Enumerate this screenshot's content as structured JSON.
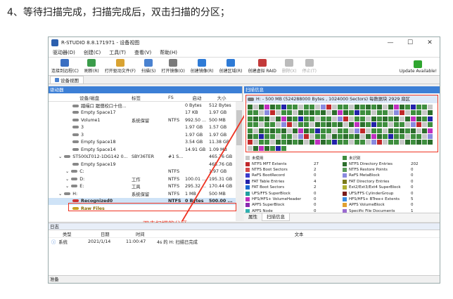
{
  "caption": "4、等待扫描完成，扫描完成后，双击扫描的分区；",
  "window": {
    "title": "R-STUDIO 8.8.171971 - 设备视图",
    "controls": [
      "—",
      "☐",
      "✕"
    ]
  },
  "menu": [
    "驱动器(D)",
    "创建(C)",
    "工具(T)",
    "查看(V)",
    "帮助(H)"
  ],
  "toolbar": [
    {
      "label": "连接到远程(C)",
      "color": "#3a6fc2",
      "disabled": false
    },
    {
      "label": "刷新(R)",
      "color": "#3a9c4a",
      "disabled": false
    },
    {
      "label": "打开驱动文件(F)",
      "color": "#d9a332",
      "disabled": false
    },
    {
      "label": "扫描(S)",
      "color": "#4a82d0",
      "disabled": false
    },
    {
      "label": "打开镜像(O)",
      "color": "#7a7a7a",
      "disabled": false
    },
    {
      "label": "创建镜像(R)",
      "color": "#2f7bd6",
      "disabled": false
    },
    {
      "label": "创建区域(R)",
      "color": "#2f7bd6",
      "disabled": false
    },
    {
      "label": "创建虚拟 RAID",
      "color": "#c33a3a",
      "disabled": false
    },
    {
      "label": "删除(X)",
      "color": "#bbbbbb",
      "disabled": true
    },
    {
      "label": "停止(T)",
      "color": "#bbbbbb",
      "disabled": true
    },
    {
      "label": "Update Available!",
      "color": "#2fa52f",
      "disabled": false
    }
  ],
  "tab": "设备视图",
  "left_panel": {
    "header": "驱动器",
    "columns": [
      "设备/磁盘",
      "标签",
      "FS",
      "启动",
      "大小"
    ],
    "rows": [
      {
        "indent": 34,
        "name": "踏缉口  踞僧校口十倍...",
        "label": "",
        "fs": "",
        "start": "0 Bytes",
        "size": "512 Bytes",
        "sel": false,
        "raw": false
      },
      {
        "indent": 34,
        "name": "Empty Space17",
        "label": "",
        "fs": "",
        "start": "17 KB",
        "size": "1.97 GB",
        "sel": false,
        "raw": false
      },
      {
        "indent": 34,
        "name": "Volume1",
        "label": "系统保留",
        "fs": "NTFS",
        "start": "992.50 ...",
        "size": "500 MB",
        "sel": false,
        "raw": false
      },
      {
        "indent": 34,
        "name": "3",
        "label": "",
        "fs": "",
        "start": "1.97 GB",
        "size": "1.57 GB",
        "sel": false,
        "raw": false
      },
      {
        "indent": 34,
        "name": "3",
        "label": "",
        "fs": "",
        "start": "1.97 GB",
        "size": "1.97 GB",
        "sel": false,
        "raw": false
      },
      {
        "indent": 34,
        "name": "Empty Space18",
        "label": "",
        "fs": "",
        "start": "3.54 GB",
        "size": "11.38 GB",
        "sel": false,
        "raw": false
      },
      {
        "indent": 34,
        "name": "Empty Space14",
        "label": "",
        "fs": "",
        "start": "14.91 GB",
        "size": "1.09 MB",
        "sel": false,
        "raw": false
      },
      {
        "indent": 14,
        "name": "ST500LT012-1DG142 0...",
        "label": "SBY36TER",
        "fs": "#1 S...",
        "start": "",
        "size": "465.76 GB",
        "sel": false,
        "raw": false
      },
      {
        "indent": 34,
        "name": "Empty Space19",
        "label": "",
        "fs": "",
        "start": "",
        "size": "465.76 GB",
        "sel": false,
        "raw": false
      },
      {
        "indent": 24,
        "name": "C:",
        "label": "",
        "fs": "NTFS",
        "start": "",
        "size": "1.97 GB",
        "sel": false,
        "raw": false
      },
      {
        "indent": 24,
        "name": "D:",
        "label": "工作",
        "fs": "NTFS",
        "start": "100.01 ...",
        "size": "195.31 GB",
        "sel": false,
        "raw": false
      },
      {
        "indent": 24,
        "name": "E:",
        "label": "工具",
        "fs": "NTFS",
        "start": "295.32 ...",
        "size": "170.44 GB",
        "sel": false,
        "raw": false
      },
      {
        "indent": 14,
        "name": "H:",
        "label": "系统保留",
        "fs": "NTFS",
        "start": "1 MB",
        "size": "500 MB",
        "sel": false,
        "raw": false
      },
      {
        "indent": 34,
        "name": "Recognized0",
        "label": "",
        "fs": "NTFS",
        "start": "0 Bytes",
        "size": "500.00 ...",
        "sel": true,
        "raw": false
      },
      {
        "indent": 34,
        "name": "Raw Files",
        "label": "",
        "fs": "",
        "start": "",
        "size": "",
        "sel": false,
        "raw": true
      }
    ]
  },
  "annotation": "双击扫描的分区",
  "right_panel": {
    "header": "扫描信息",
    "disk_info": "H: - 500 MB (524288000 Bytes , 1024000 Sectors) 每数据块 2929 扇区",
    "legend": [
      {
        "label": "未使用",
        "count": "",
        "color": "#c8c8c8"
      },
      {
        "label": "未识别",
        "count": "",
        "color": "#3e8e3e"
      },
      {
        "label": "NTFS MFT Extents",
        "count": "27",
        "color": "#c0282a"
      },
      {
        "label": "NTFS Directory Entries",
        "count": "202",
        "color": "#2c6e2c"
      },
      {
        "label": "NTFS Boot Sectors",
        "count": "2",
        "color": "#d44a4a"
      },
      {
        "label": "NTFS Restore Points",
        "count": "0",
        "color": "#5a9a5a"
      },
      {
        "label": "ReFS BootRecord",
        "count": "0",
        "color": "#3a3acc"
      },
      {
        "label": "ReFS MetaBlock",
        "count": "0",
        "color": "#8a8ae0"
      },
      {
        "label": "FAT Table Entries",
        "count": "4",
        "color": "#2222aa"
      },
      {
        "label": "FAT Directory Entries",
        "count": "0",
        "color": "#7a7a1a"
      },
      {
        "label": "FAT Boot Sectors",
        "count": "2",
        "color": "#1a6ad0"
      },
      {
        "label": "Ext2/Ext3/Ext4 SuperBlock",
        "count": "0",
        "color": "#b0b030"
      },
      {
        "label": "UFS/FFS SuperBlock",
        "count": "0",
        "color": "#1f9f9f"
      },
      {
        "label": "UFS/FFS CylinderGroup",
        "count": "0",
        "color": "#7a1a1a"
      },
      {
        "label": "HFS/HFS+ VolumeHeader",
        "count": "0",
        "color": "#c030c0"
      },
      {
        "label": "HFS/HFS+ BTree+ Extents",
        "count": "5",
        "color": "#3a8ae0"
      },
      {
        "label": "APFS SuperBlock",
        "count": "0",
        "color": "#8a2ab0"
      },
      {
        "label": "APFS VolumeBlock",
        "count": "0",
        "color": "#e0a030"
      },
      {
        "label": "APFS Node",
        "count": "0",
        "color": "#30b0b0"
      },
      {
        "label": "Specific File Documents",
        "count": "1",
        "color": "#9a6ad0"
      }
    ],
    "tabs": [
      "属性",
      "扫描信息"
    ]
  },
  "log": {
    "header": "日志",
    "columns": [
      "类型",
      "日期",
      "时间",
      "文本"
    ],
    "rows": [
      {
        "type": "系统",
        "date": "2021/1/14",
        "time": "11:00:47",
        "text": "4s 的 H: 扫描已完成"
      }
    ]
  },
  "status": "准备"
}
